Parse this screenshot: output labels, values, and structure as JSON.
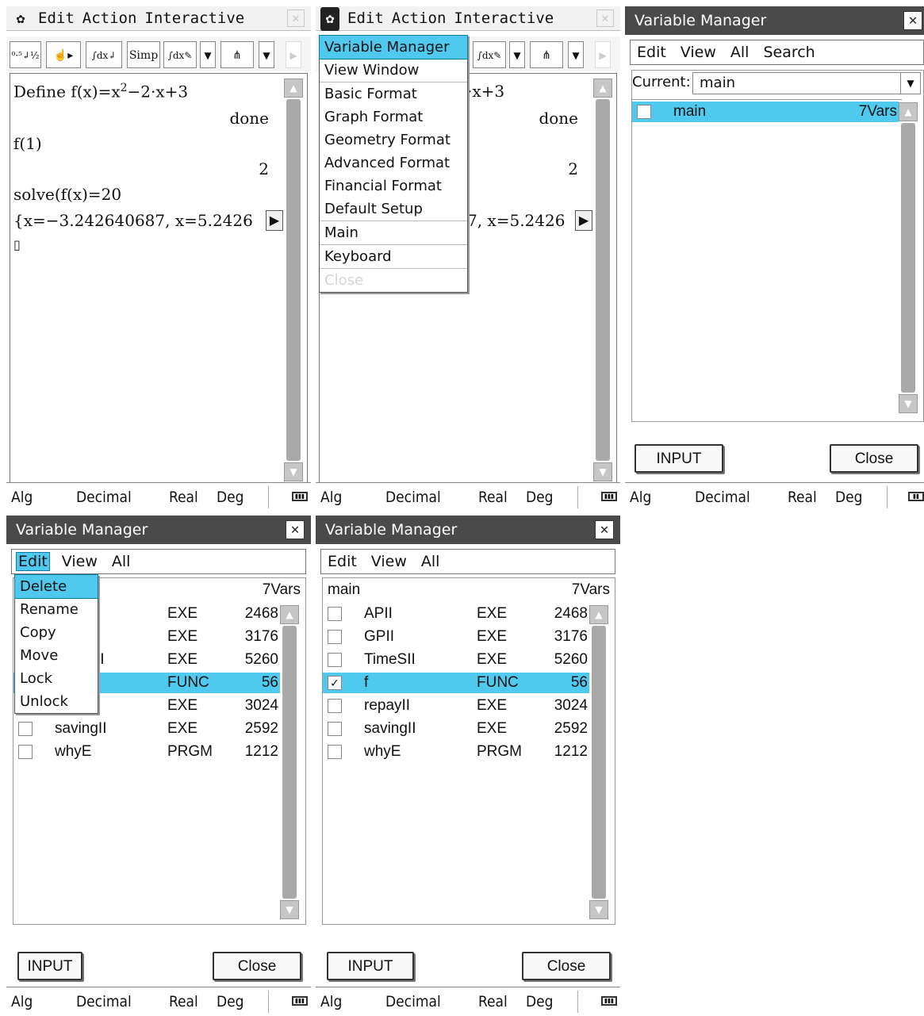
{
  "colors": {
    "highlight": "#4fc9ee",
    "title_bar": "#4a4a4a",
    "scrollbar": "#a9a9a9"
  },
  "status": {
    "mode": "Alg",
    "format": "Decimal",
    "domain": "Real",
    "angle": "Deg"
  },
  "main": {
    "menu": [
      "Edit",
      "Action",
      "Interactive"
    ],
    "toolbar": {
      "b1": "0.5 1 ↲ 2",
      "b3": "∫dx ∫dx",
      "b4": "Simp",
      "b5": "∫dx"
    },
    "lines": [
      {
        "text": "Define f(x)=x",
        "sup": "2",
        "rest": "−2·x+3"
      },
      {
        "result": "done"
      },
      {
        "text": "f(1)"
      },
      {
        "result": "2"
      },
      {
        "text": "solve(f(x)=20"
      },
      {
        "text": "{x=−3.242640687, x=5.2426"
      },
      {
        "text": "▯"
      }
    ],
    "partial_line1": "·x+3",
    "partial_line6": "7, x=5.2426"
  },
  "settings_menu": {
    "items": [
      "Variable Manager",
      "View Window",
      "Basic Format",
      "Graph Format",
      "Geometry Format",
      "Advanced Format",
      "Financial Format",
      "Default Setup",
      "Main",
      "Keyboard",
      "Close"
    ]
  },
  "vm": {
    "title": "Variable Manager",
    "menu": [
      "Edit",
      "View",
      "All",
      "Search"
    ],
    "current_label": "Current:",
    "current_value": "main",
    "folder": {
      "name": "main",
      "count": "7Vars"
    },
    "list_header": {
      "folder": "main",
      "count": "7Vars"
    },
    "edit_menu": [
      "Delete",
      "Rename",
      "Copy",
      "Move",
      "Lock",
      "Unlock"
    ],
    "vars": [
      {
        "name": "APII",
        "type": "EXE",
        "size": "2468",
        "checked": false
      },
      {
        "name": "GPII",
        "type": "EXE",
        "size": "3176",
        "checked": false
      },
      {
        "name": "TimeSII",
        "type": "EXE",
        "size": "5260",
        "checked": false
      },
      {
        "name": "f",
        "type": "FUNC",
        "size": "56",
        "checked": true
      },
      {
        "name": "repayII",
        "type": "EXE",
        "size": "3024",
        "checked": false
      },
      {
        "name": "savingII",
        "type": "EXE",
        "size": "2592",
        "checked": false
      },
      {
        "name": "whyE",
        "type": "PRGM",
        "size": "1212",
        "checked": false
      }
    ],
    "partial_names": {
      "r3": "II",
      "r5": "I"
    },
    "check_mark": "✓",
    "input_label": "INPUT",
    "close_label": "Close"
  }
}
